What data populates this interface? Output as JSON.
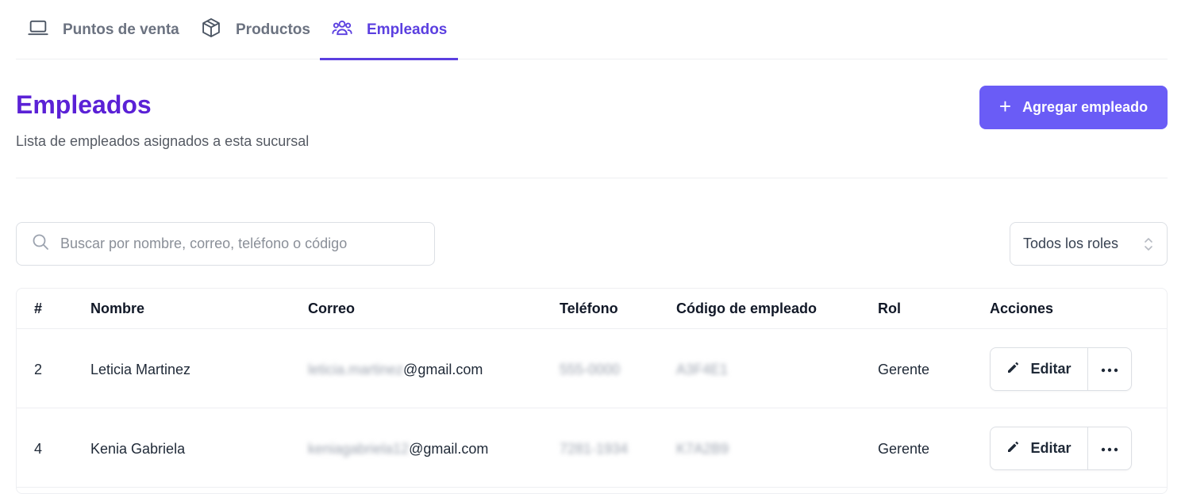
{
  "tabs": [
    {
      "label": "Puntos de venta",
      "icon": "laptop-icon",
      "active": false
    },
    {
      "label": "Productos",
      "icon": "box-icon",
      "active": false
    },
    {
      "label": "Empleados",
      "icon": "users-icon",
      "active": true
    }
  ],
  "header": {
    "title": "Empleados",
    "subtitle": "Lista de empleados asignados a esta sucursal",
    "add_button_label": "Agregar empleado"
  },
  "filters": {
    "search_placeholder": "Buscar por nombre, correo, teléfono o código",
    "search_value": "",
    "role_selected": "Todos los roles"
  },
  "table": {
    "columns": [
      "#",
      "Nombre",
      "Correo",
      "Teléfono",
      "Código de empleado",
      "Rol",
      "Acciones"
    ],
    "rows": [
      {
        "id": "2",
        "name": "Leticia Martinez",
        "email_hidden": "leticia.martinez",
        "email_domain": "@gmail.com",
        "phone": "555-0000",
        "code": "A3F4E1",
        "role": "Gerente",
        "edit_label": "Editar"
      },
      {
        "id": "4",
        "name": "Kenia Gabriela",
        "email_hidden": "keniagabriela12",
        "email_domain": "@gmail.com",
        "phone": "7281-1934",
        "code": "K7A2B9",
        "role": "Gerente",
        "edit_label": "Editar"
      }
    ]
  },
  "colors": {
    "accent": "#5b3fe0",
    "title": "#5b21d6",
    "button": "#6a5cf6"
  }
}
